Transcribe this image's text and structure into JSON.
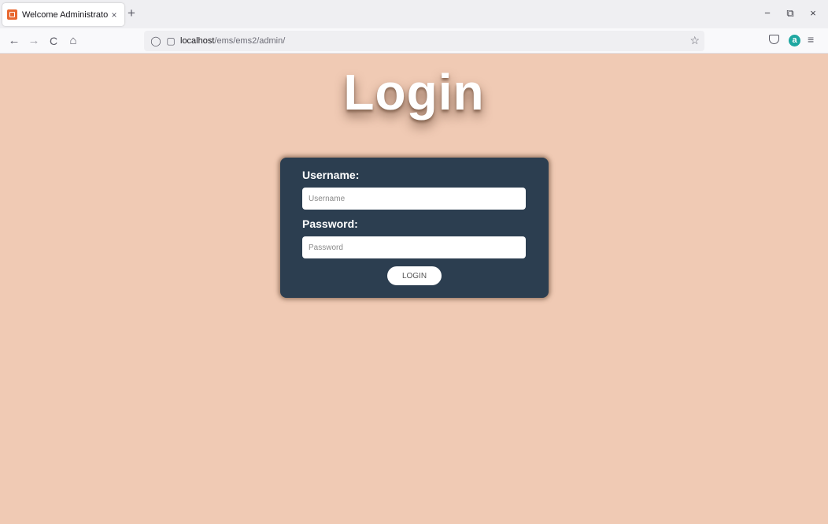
{
  "browser": {
    "tab_title": "Welcome Administrator",
    "url_host": "localhost",
    "url_path": "/ems/ems2/admin/",
    "icons": {
      "favicon": "app-favicon",
      "tab_close": "close-icon",
      "new_tab": "plus-icon",
      "back": "arrow-left-icon",
      "forward": "arrow-right-icon",
      "reload": "reload-icon",
      "home": "home-icon",
      "shield": "shield-icon",
      "page": "page-icon",
      "bookmark": "star-icon",
      "pocket": "pocket-icon",
      "amazon": "amazon-extension-icon",
      "menu": "hamburger-menu-icon"
    },
    "glyphs": {
      "tab_close": "×",
      "new_tab": "+",
      "back": "←",
      "forward": "→",
      "reload": "C",
      "home": "⌂",
      "shield": "◯",
      "page": "▢",
      "bookmark": "☆",
      "amazon": "a",
      "menu": "≡",
      "minimize": "−",
      "restore": "⧉",
      "close": "×"
    }
  },
  "page": {
    "heading": "Login",
    "form": {
      "username_label": "Username:",
      "username_placeholder": "Username",
      "password_label": "Password:",
      "password_placeholder": "Password",
      "login_button": "LOGIN"
    }
  },
  "colors": {
    "page_background": "#f0cab4",
    "card_background": "#2c3e50",
    "heading_text": "#ffffff"
  }
}
